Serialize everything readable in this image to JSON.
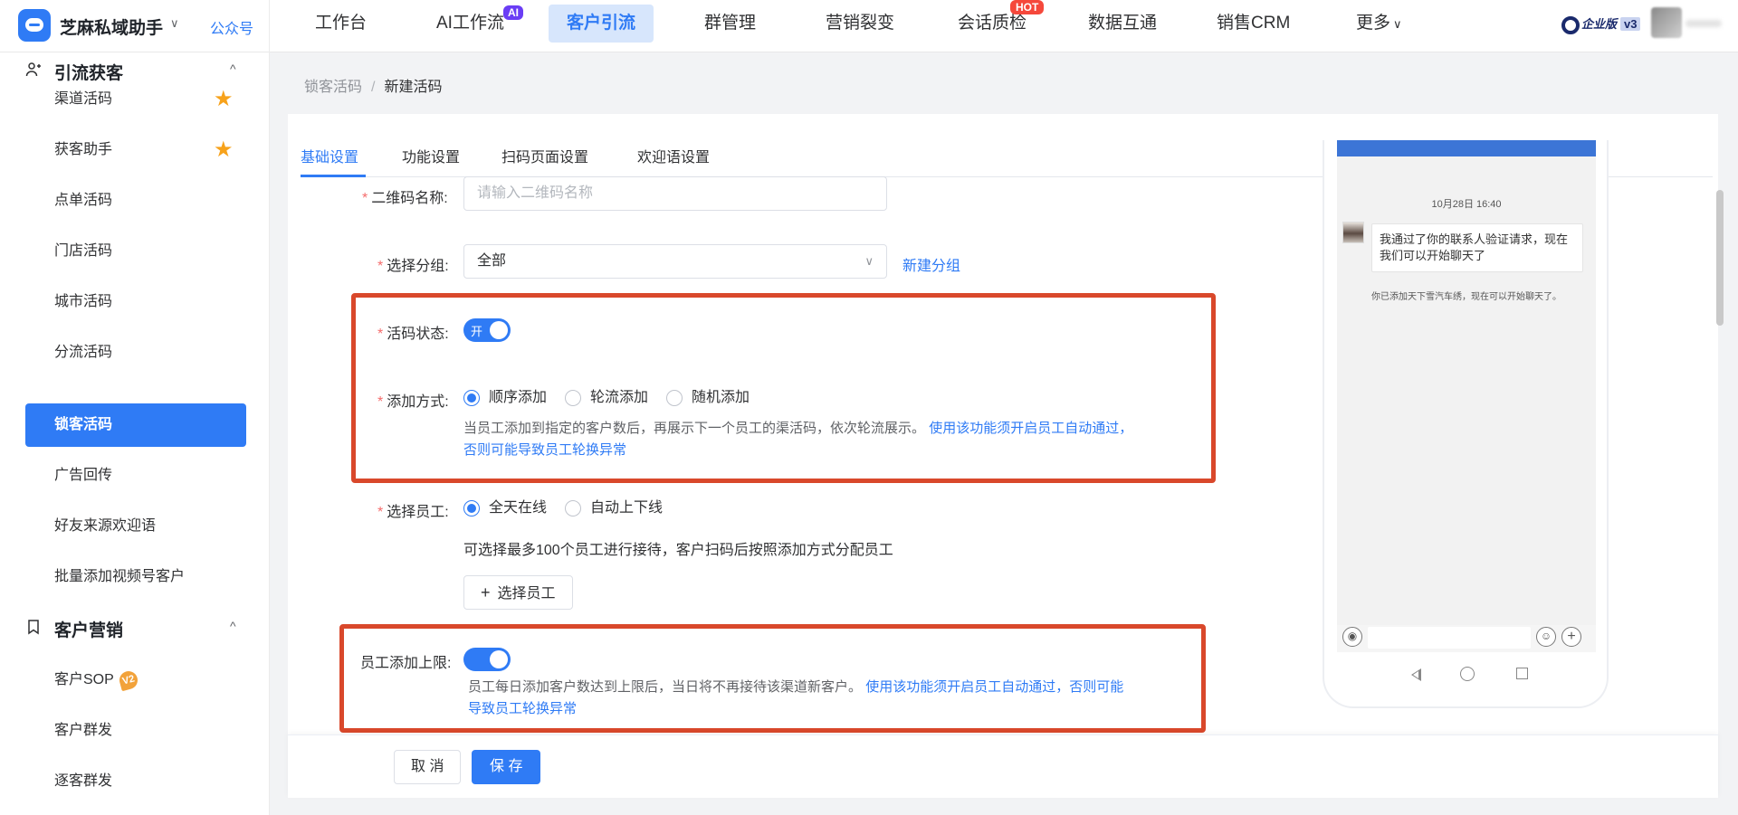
{
  "brand": {
    "name": "芝麻私域助手",
    "caret": "∨",
    "gzh": "公众号"
  },
  "nav": {
    "items": [
      "工作台",
      "AI工作流",
      "客户引流",
      "群管理",
      "营销裂变",
      "会话质检",
      "数据互通",
      "销售CRM",
      "更多"
    ],
    "ai_badge": "AI",
    "hot_badge": "HOT",
    "more_caret": "∨",
    "enterprise": "企业版",
    "enterprise_level": "v3"
  },
  "sidebar": {
    "group1": "引流获客",
    "items1": [
      "渠道活码",
      "获客助手",
      "点单活码",
      "门店活码",
      "城市活码",
      "分流活码",
      "锁客活码",
      "广告回传",
      "好友来源欢迎语",
      "批量添加视频号客户"
    ],
    "group2": "客户营销",
    "items2": [
      "客户SOP",
      "客户群发",
      "逐客群发"
    ],
    "sop_badge": "V2",
    "caret": "^"
  },
  "breadcrumb": {
    "parent": "锁客活码",
    "sep": "/",
    "current": "新建活码"
  },
  "tabs": [
    "基础设置",
    "功能设置",
    "扫码页面设置",
    "欢迎语设置"
  ],
  "form": {
    "required_mark": "*",
    "qr_name_label": "二维码名称:",
    "qr_name_placeholder": "请输入二维码名称",
    "group_label": "选择分组:",
    "group_value": "全部",
    "group_caret": "∨",
    "new_group": "新建分组",
    "status_label": "活码状态:",
    "status_on_text": "开",
    "add_mode_label": "添加方式:",
    "add_modes": [
      "顺序添加",
      "轮流添加",
      "随机添加"
    ],
    "add_mode_hint_plain": "当员工添加到指定的客户数后，再展示下一个员工的渠活码，依次轮流展示。",
    "add_mode_hint_link1": "使用该功能须开启员工自动通过，",
    "add_mode_hint_link2": "否则可能导致员工轮换异常",
    "staff_label": "选择员工:",
    "staff_modes": [
      "全天在线",
      "自动上下线"
    ],
    "staff_hint": "可选择最多100个员工进行接待，客户扫码后按照添加方式分配员工",
    "select_staff_icon": "+",
    "select_staff_btn": "选择员工",
    "limit_label": "员工添加上限:",
    "limit_hint_plain": "员工每日添加客户数达到上限后，当日将不再接待该渠道新客户。",
    "limit_hint_link1": "使用该功能须开启员工自动通过，否则可能",
    "limit_hint_link2": "导致员工轮换异常"
  },
  "preview": {
    "time": "10月28日 16:40",
    "message": "我通过了你的联系人验证请求，现在我们可以开始聊天了",
    "system": "你已添加天下雪汽车绣，现在可以开始聊天了。",
    "voice_icon": "◉",
    "emoji_icon": "☺",
    "plus_icon": "+"
  },
  "footer": {
    "cancel": "取 消",
    "save": "保 存"
  },
  "colors": {
    "accent": "#2f7bf5",
    "highlight_frame": "#d9482b",
    "star": "#f7a21b"
  }
}
